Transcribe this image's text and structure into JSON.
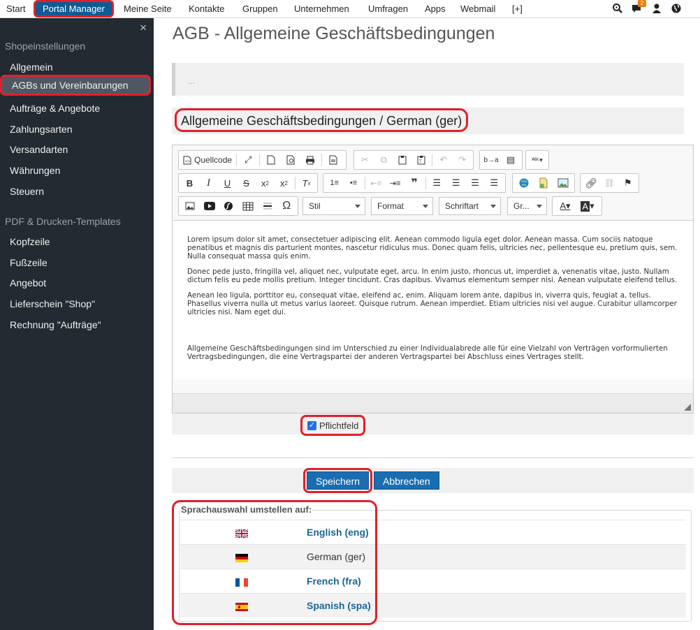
{
  "topnav": {
    "items": [
      "Start",
      "Portal Manager",
      "Meine Seite",
      "Kontakte",
      "Gruppen",
      "Unternehmen",
      "Umfragen",
      "Apps",
      "Webmail",
      "[+]"
    ],
    "notification_count": "2",
    "icons": [
      "search-icon",
      "chat-icon",
      "user-icon",
      "globe-icon"
    ]
  },
  "sidebar": {
    "close": "×",
    "section1": "Shopeinstellungen",
    "items1": [
      "Allgemein",
      "AGBs und Vereinbarungen",
      "Aufträge & Angebote",
      "Zahlungsarten",
      "Versandarten",
      "Währungen",
      "Steuern"
    ],
    "section2": "PDF & Drucken-Templates",
    "items2": [
      "Kopfzeile",
      "Fußzeile",
      "Angebot",
      "Lieferschein \"Shop\"",
      "Rechnung \"Aufträge\""
    ]
  },
  "main": {
    "title": "AGB - Allgemeine Geschäftsbedingungen",
    "breadcrumb": "...",
    "section_heading": "Allgemeine Geschäftsbedingungen / German (ger)"
  },
  "editor": {
    "source_label": "Quellcode",
    "combos": [
      "Stil",
      "Format",
      "Schriftart",
      "Gr..."
    ],
    "paragraphs": [
      "Lorem ipsum dolor sit amet, consectetuer adipiscing elit. Aenean commodo ligula eget dolor. Aenean massa. Cum sociis natoque penatibus et magnis dis parturient montes, nascetur ridiculus mus. Donec quam felis, ultricies nec, pellentesque eu, pretium quis, sem. Nulla consequat massa quis enim.",
      "Donec pede justo, fringilla vel, aliquet nec, vulputate eget, arcu. In enim justo, rhoncus ut, imperdiet a, venenatis vitae, justo. Nullam dictum felis eu pede mollis pretium. Integer tincidunt. Cras dapibus. Vivamus elementum semper nisi. Aenean vulputate eleifend tellus.",
      "Aenean leo ligula, porttitor eu, consequat vitae, eleifend ac, enim. Aliquam lorem ante, dapibus in, viverra quis, feugiat a, tellus. Phasellus viverra nulla ut metus varius laoreet. Quisque rutrum. Aenean imperdiet. Etiam ultricies nisi vel augue. Curabitur ullamcorper ultricies nisi. Nam eget dui.",
      "Allgemeine Geschäftsbedingungen sind im Unterschied zu einer Individualabrede alle für eine Vielzahl von Verträgen vorformulierten Vertragsbedingungen, die eine Vertragspartei der anderen Vertragspartei bei Abschluss eines Vertrages stellt."
    ]
  },
  "form": {
    "required_label": "Pflichtfeld",
    "required_checked": true,
    "save_label": "Speichern",
    "cancel_label": "Abbrechen"
  },
  "languages": {
    "legend": "Sprachauswahl umstellen auf:",
    "items": [
      {
        "name": "English (eng)",
        "flag": "uk-flag-icon",
        "current": false
      },
      {
        "name": "German (ger)",
        "flag": "de-flag-icon",
        "current": true
      },
      {
        "name": "French (fra)",
        "flag": "fr-flag-icon",
        "current": false
      },
      {
        "name": "Spanish (spa)",
        "flag": "es-flag-icon",
        "current": false
      }
    ]
  },
  "colors": {
    "sidebar_bg": "#232a31",
    "accent_blue": "#1a6db0",
    "highlight_red": "#e0202a",
    "link_blue": "#1a6694"
  }
}
